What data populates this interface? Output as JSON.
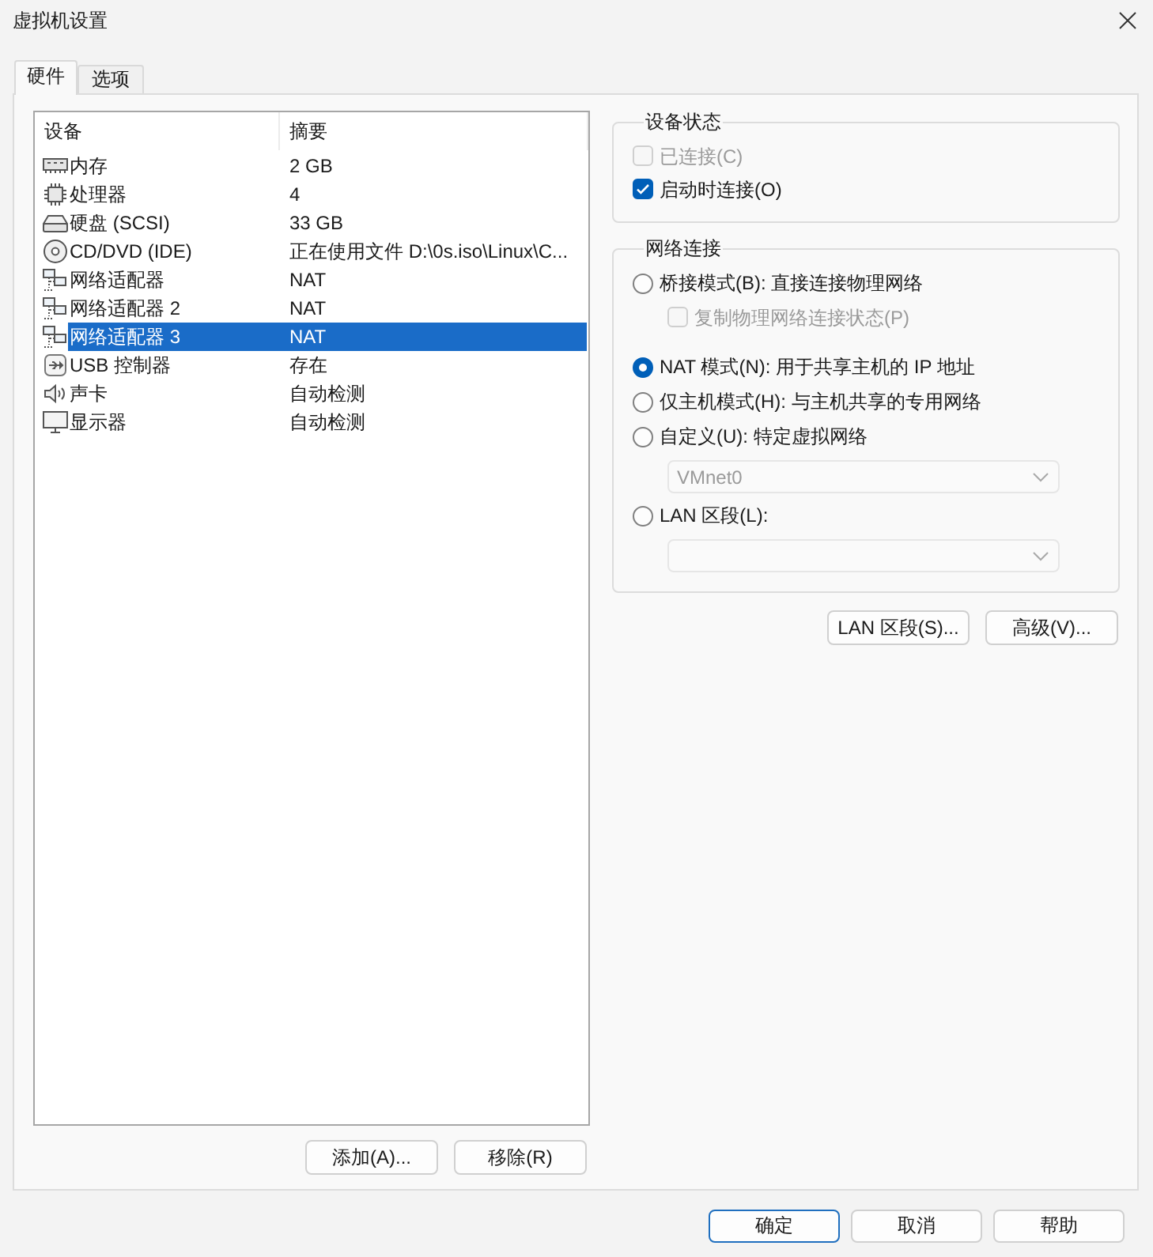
{
  "window": {
    "title": "虚拟机设置"
  },
  "tabs": [
    {
      "label": "硬件",
      "selected": true
    },
    {
      "label": "选项",
      "selected": false
    }
  ],
  "device_list": {
    "columns": [
      "设备",
      "摘要"
    ],
    "rows": [
      {
        "kind": "memory",
        "device": "内存",
        "summary": "2 GB",
        "selected": false
      },
      {
        "kind": "processor",
        "device": "处理器",
        "summary": "4",
        "selected": false
      },
      {
        "kind": "disk",
        "device": "硬盘 (SCSI)",
        "summary": "33 GB",
        "selected": false
      },
      {
        "kind": "cdrom",
        "device": "CD/DVD (IDE)",
        "summary": "正在使用文件 D:\\0s.iso\\Linux\\C...",
        "selected": false
      },
      {
        "kind": "network",
        "device": "网络适配器",
        "summary": "NAT",
        "selected": false
      },
      {
        "kind": "network",
        "device": "网络适配器 2",
        "summary": "NAT",
        "selected": false
      },
      {
        "kind": "network",
        "device": "网络适配器 3",
        "summary": "NAT",
        "selected": true
      },
      {
        "kind": "usb",
        "device": "USB 控制器",
        "summary": "存在",
        "selected": false
      },
      {
        "kind": "sound",
        "device": "声卡",
        "summary": "自动检测",
        "selected": false
      },
      {
        "kind": "display",
        "device": "显示器",
        "summary": "自动检测",
        "selected": false
      }
    ]
  },
  "list_buttons": [
    "添加(A)...",
    "移除(R)"
  ],
  "device_status": {
    "title": "设备状态",
    "options": [
      {
        "label": "已连接(C)",
        "checked": false,
        "disabled": true
      },
      {
        "label": "启动时连接(O)",
        "checked": true,
        "disabled": false
      }
    ]
  },
  "network_connection": {
    "title": "网络连接",
    "items": [
      {
        "kind": "radio",
        "label": "桥接模式(B): 直接连接物理网络",
        "selected": false
      },
      {
        "kind": "checkbox",
        "label": "复制物理网络连接状态(P)",
        "checked": false,
        "disabled": true
      },
      {
        "kind": "radio",
        "label": "NAT 模式(N): 用于共享主机的 IP 地址",
        "selected": true
      },
      {
        "kind": "radio",
        "label": "仅主机模式(H): 与主机共享的专用网络",
        "selected": false
      },
      {
        "kind": "radio",
        "label": "自定义(U): 特定虚拟网络",
        "selected": false
      },
      {
        "kind": "select",
        "value": "VMnet0",
        "disabled": true
      },
      {
        "kind": "radio",
        "label": "LAN 区段(L):",
        "selected": false
      },
      {
        "kind": "select",
        "disabled": true
      }
    ]
  },
  "network_buttons": [
    "LAN 区段(S)...",
    "高级(V)..."
  ],
  "dialog_buttons": [
    {
      "label": "确定",
      "default": true
    },
    {
      "label": "取消",
      "default": false
    },
    {
      "label": "帮助",
      "default": false
    }
  ]
}
